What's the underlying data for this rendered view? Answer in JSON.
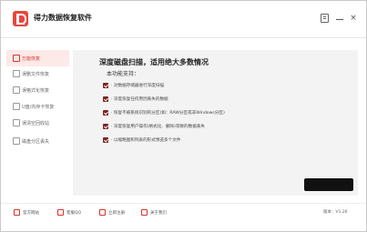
{
  "app": {
    "title": "得力数据恢复软件"
  },
  "window_controls": {
    "menu": "",
    "minimize": "",
    "close": "×"
  },
  "sidebar": {
    "items": [
      {
        "label": "万能恢复",
        "active": true
      },
      {
        "label": "误删文件恢复",
        "active": false
      },
      {
        "label": "误格式化恢复",
        "active": false
      },
      {
        "label": "U盘/内存卡恢复",
        "active": false
      },
      {
        "label": "误清空回收站",
        "active": false
      },
      {
        "label": "磁盘分区丢失",
        "active": false
      }
    ]
  },
  "main": {
    "heading": "深度磁盘扫描，适用绝大多数情况",
    "subheading": "本功能支持：",
    "features": [
      "· 对数据存储器进行深度扫描",
      "· 深度恢复任何原因丢失的数据",
      "· 恢复不被系统识别的分区(如：RAW分区或非Windows分区)",
      "· 深度恢复用户操作(格式化、删除)等致的数据丢失",
      "· 以缩略图和列表的形式预览多个文件"
    ],
    "start_button": ""
  },
  "bottom_bar": {
    "items": [
      {
        "label": "官方网站",
        "icon": "home-icon"
      },
      {
        "label": "客服QQ",
        "icon": "chat-icon"
      },
      {
        "label": "立即注册",
        "icon": "register-icon"
      },
      {
        "label": "关于我们",
        "icon": "info-icon"
      }
    ],
    "version": "版本：V1.26"
  },
  "colors": {
    "accent": "#d9332a",
    "active_bg": "#fde9e8",
    "panel_bg": "#f3f3f3"
  }
}
